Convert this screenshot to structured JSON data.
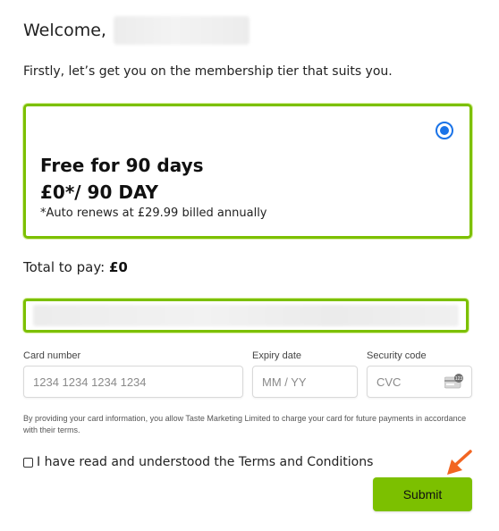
{
  "header": {
    "welcome": "Welcome,"
  },
  "intro": "Firstly, let’s get you on the membership tier that suits you.",
  "tier": {
    "title": "Free for 90 days",
    "price": "£0*/ 90 DAY",
    "note": "*Auto renews at £29.99 billed annually",
    "selected": true
  },
  "total": {
    "label": "Total to pay:",
    "amount": "£0"
  },
  "payment": {
    "card_number_label": "Card number",
    "card_number_placeholder": "1234 1234 1234 1234",
    "expiry_label": "Expiry date",
    "expiry_placeholder": "MM / YY",
    "security_label": "Security code",
    "security_placeholder": "CVC",
    "cvc_icon": "card-cvc-icon"
  },
  "consent": "By providing your card information, you allow Taste Marketing Limited to charge your card for future payments in accordance with their terms.",
  "terms": {
    "label": "I have read and understood the Terms and Conditions",
    "checked": false
  },
  "submit_label": "Submit",
  "colors": {
    "accent": "#7cc000",
    "radio": "#1a73e8",
    "arrow": "#f26522"
  }
}
